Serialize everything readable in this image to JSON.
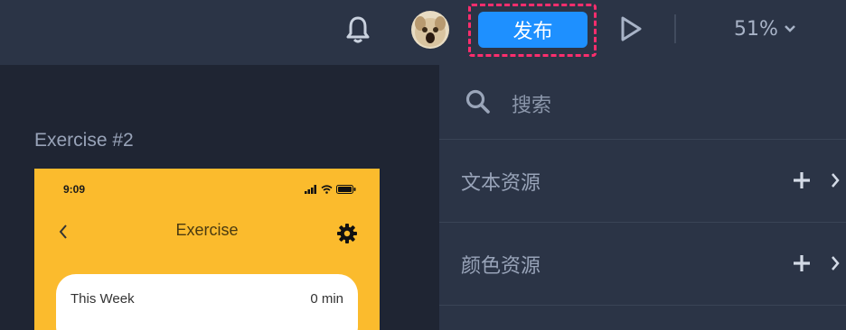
{
  "topbar": {
    "publish_label": "发布",
    "zoom_value": "51%"
  },
  "canvas": {
    "frame_title": "Exercise #2",
    "phone": {
      "time": "9:09",
      "title": "Exercise",
      "card_label": "This Week",
      "card_value": "0 min"
    }
  },
  "panel": {
    "search_placeholder": "搜索",
    "resources": [
      {
        "label": "文本资源"
      },
      {
        "label": "颜色资源"
      }
    ]
  },
  "colors": {
    "accent": "#1e90ff",
    "highlight": "#ff2d6d",
    "phone_bg": "#fbbb2d"
  }
}
